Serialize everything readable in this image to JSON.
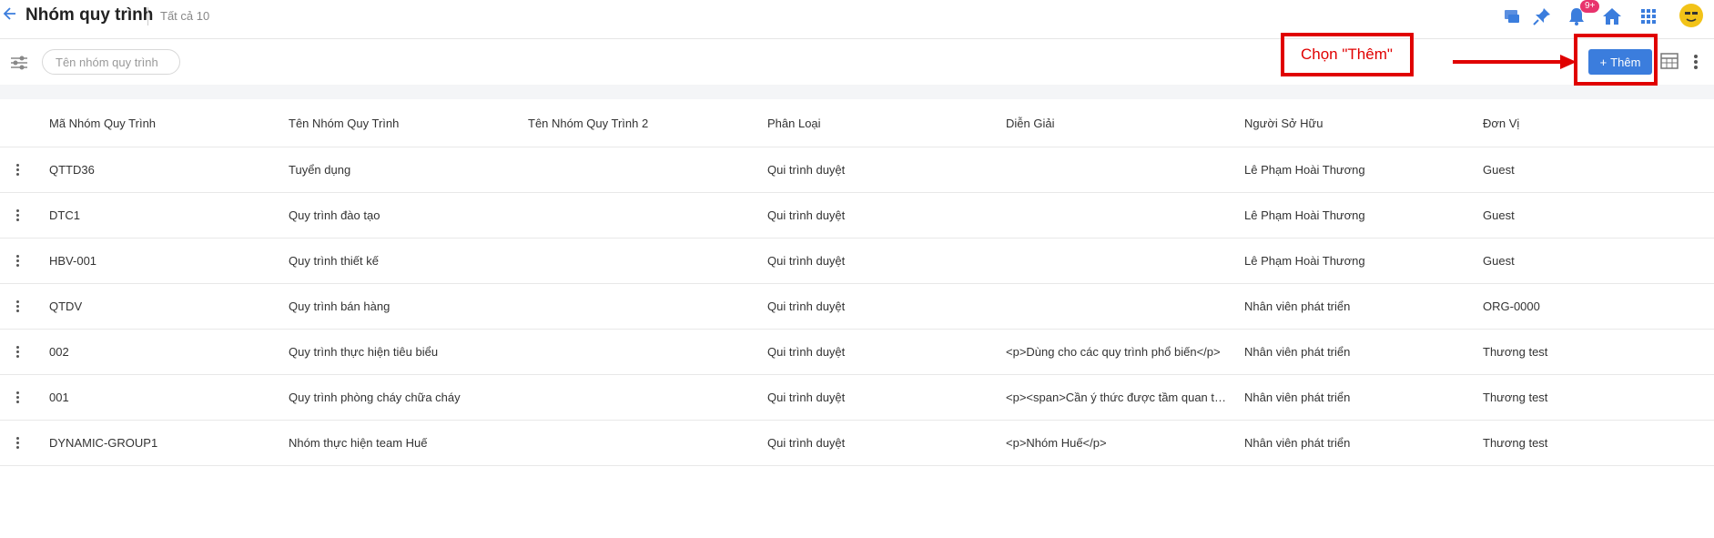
{
  "header": {
    "title": "Nhóm quy trình",
    "count_label": "Tất cả 10",
    "notification_badge": "9+"
  },
  "toolbar": {
    "search_placeholder": "Tên nhóm quy trình",
    "add_label": "Thêm",
    "add_prefix": "+"
  },
  "annotation": {
    "callout_text": "Chọn \"Thêm\"",
    "color": "#e00000"
  },
  "colors": {
    "accent": "#3b7ddd",
    "badge": "#e8336d"
  },
  "table": {
    "columns": [
      "Mã Nhóm Quy Trình",
      "Tên Nhóm Quy Trình",
      "Tên Nhóm Quy Trình 2",
      "Phân Loại",
      "Diễn Giải",
      "Người Sở Hữu",
      "Đơn Vị"
    ],
    "rows": [
      [
        "QTTD36",
        "Tuyển dụng",
        "",
        "Qui trình duyệt",
        "",
        "Lê Phạm Hoài Thương",
        "Guest"
      ],
      [
        "DTC1",
        "Quy trình đào tạo",
        "",
        "Qui trình duyệt",
        "",
        "Lê Phạm Hoài Thương",
        "Guest"
      ],
      [
        "HBV-001",
        "Quy trình thiết kế",
        "",
        "Qui trình duyệt",
        "",
        "Lê Phạm Hoài Thương",
        "Guest"
      ],
      [
        "QTDV",
        "Quy trình bán hàng",
        "",
        "Qui trình duyệt",
        "",
        "Nhân viên phát triển",
        "ORG-0000"
      ],
      [
        "002",
        "Quy trình thực hiện tiêu biểu",
        "",
        "Qui trình duyệt",
        "<p>Dùng cho các quy trình phổ biến</p>",
        "Nhân viên phát triển",
        "Thương test"
      ],
      [
        "001",
        "Quy trình phòng cháy chữa cháy",
        "",
        "Qui trình duyệt",
        "<p><span>Cần ý thức được tầm quan trọ...",
        "Nhân viên phát triển",
        "Thương test"
      ],
      [
        "DYNAMIC-GROUP1",
        "Nhóm thực hiện team Huế",
        "",
        "Qui trình duyệt",
        "<p>Nhóm Huế</p>",
        "Nhân viên phát triển",
        "Thương test"
      ]
    ]
  }
}
